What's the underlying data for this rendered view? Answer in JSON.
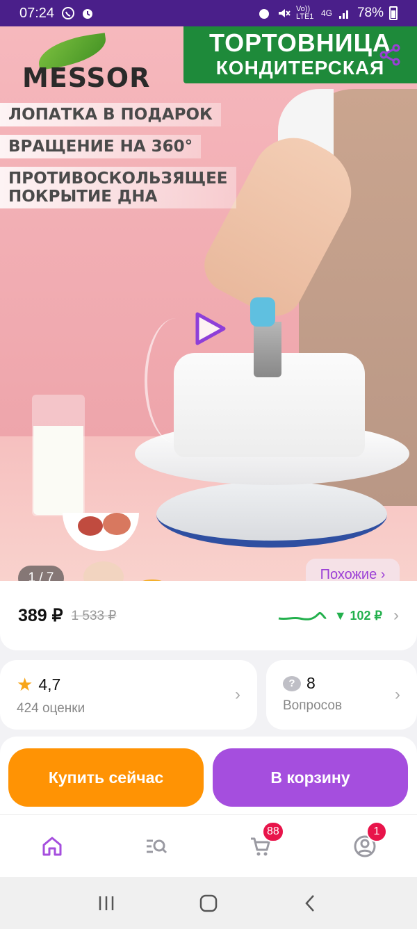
{
  "status_bar": {
    "time": "07:24",
    "network": "Vo)) LTE1",
    "signal": "4G",
    "battery": "78%"
  },
  "hero": {
    "brand": "MESSOR",
    "title_line1": "ТОРТОВНИЦА",
    "title_line2": "КОНДИТЕРСКАЯ",
    "features": [
      "ЛОПАТКА В ПОДАРОК",
      "ВРАЩЕНИЕ НА 360°",
      "ПРОТИВОСКОЛЬЗЯЩЕЕ\nПОКРЫТИЕ ДНА"
    ],
    "image_counter": "1 / 7",
    "similar_label": "Похожие ›"
  },
  "price": {
    "current": "389 ₽",
    "old": "1 533 ₽",
    "drop": "▼ 102 ₽"
  },
  "rating": {
    "value": "4,7",
    "count_label": "424 оценки"
  },
  "questions": {
    "count": "8",
    "label": "Вопросов"
  },
  "actions": {
    "buy_now": "Купить сейчас",
    "add_to_cart": "В корзину"
  },
  "bottom_nav": {
    "cart_badge": "88",
    "profile_badge": "1"
  },
  "colors": {
    "accent_purple": "#a54ede",
    "buy_orange": "#ff9304",
    "status_bar": "#4a1f8a",
    "price_drop_green": "#23b04d",
    "badge_red": "#e8144a"
  }
}
